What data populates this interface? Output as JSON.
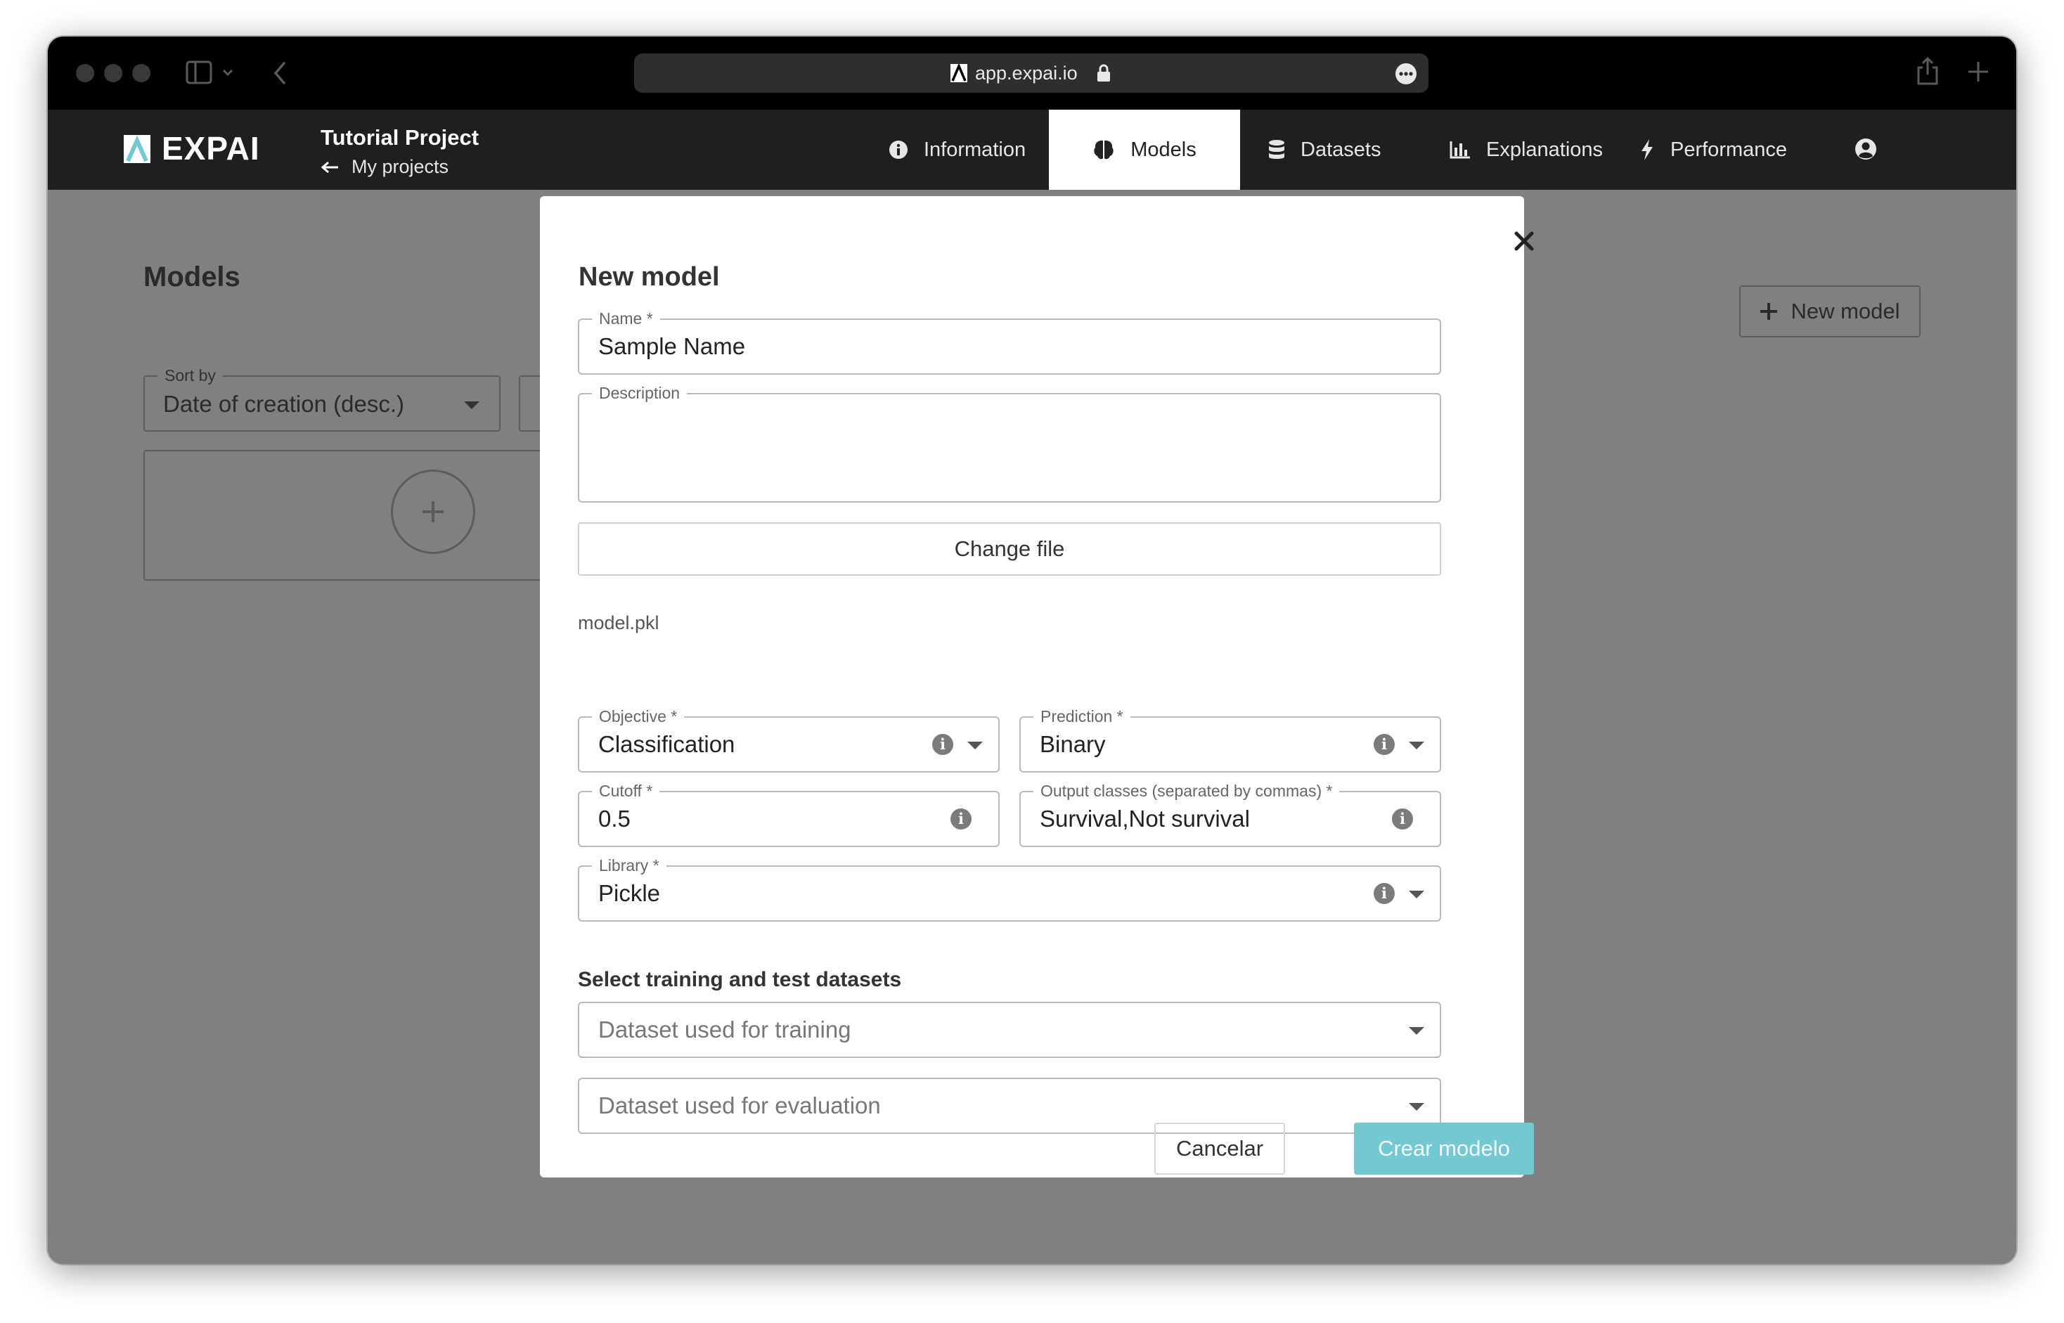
{
  "browser": {
    "url": "app.expai.io"
  },
  "app": {
    "logo_text": "EXPAI",
    "project_title": "Tutorial Project",
    "back_link": "My projects",
    "nav": [
      {
        "label": "Information",
        "icon": "info-circle-icon"
      },
      {
        "label": "Models",
        "icon": "brain-icon",
        "active": true
      },
      {
        "label": "Datasets",
        "icon": "database-icon"
      },
      {
        "label": "Explanations",
        "icon": "bar-chart-icon"
      },
      {
        "label": "Performance",
        "icon": "bolt-icon"
      }
    ],
    "user_icon": "user-circle-icon"
  },
  "page": {
    "title": "Models",
    "new_model_button": "New model",
    "sort_label": "Sort by",
    "sort_value": "Date of creation (desc.)"
  },
  "modal": {
    "title": "New model",
    "name_label": "Name *",
    "name_value": "Sample Name",
    "description_label": "Description",
    "description_value": "",
    "change_file_button": "Change file",
    "file_name": "model.pkl",
    "objective_label": "Objective *",
    "objective_value": "Classification",
    "prediction_label": "Prediction *",
    "prediction_value": "Binary",
    "cutoff_label": "Cutoff *",
    "cutoff_value": "0.5",
    "output_classes_label": "Output classes (separated by commas) *",
    "output_classes_value": "Survival,Not survival",
    "library_label": "Library *",
    "library_value": "Pickle",
    "datasets_heading": "Select training and test datasets",
    "training_placeholder": "Dataset used for training",
    "evaluation_placeholder": "Dataset used for evaluation",
    "cancel_button": "Cancelar",
    "create_button": "Crear modelo"
  },
  "colors": {
    "accent": "#74c8d2",
    "navbar": "#1f1f1f",
    "overlay": "#808080"
  }
}
